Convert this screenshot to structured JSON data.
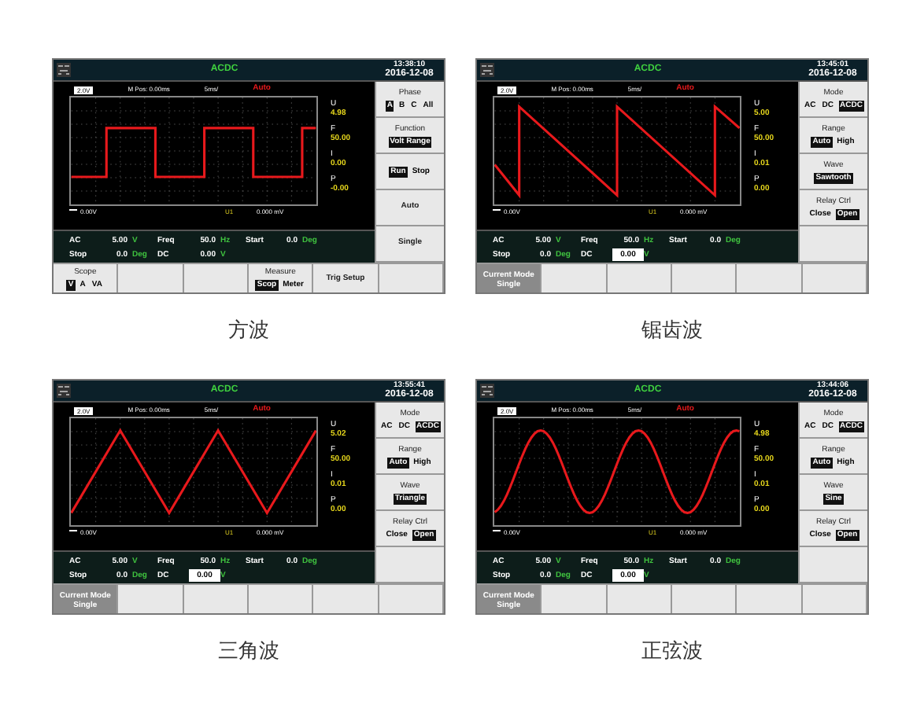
{
  "screens": [
    {
      "title": "ACDC",
      "time": "13:38:10",
      "date": "2016-12-08",
      "plot": {
        "volts_div": "2.0V",
        "m_pos": "M Pos: 0.00ms",
        "time_div": "5ms/",
        "trigger_mode": "Auto",
        "ground_level": "0.00V",
        "cursor": "U1",
        "cursor_value": "0.000 mV",
        "wave": {
          "kind": "square"
        }
      },
      "readings": [
        {
          "label": "U",
          "value": "4.98"
        },
        {
          "label": "F",
          "value": "50.00"
        },
        {
          "label": "I",
          "value": "0.00"
        },
        {
          "label": "P",
          "value": "-0.00"
        }
      ],
      "measurements": [
        [
          {
            "kind": "label",
            "text": "AC"
          },
          {
            "kind": "value",
            "text": "5.00"
          },
          {
            "kind": "unit",
            "text": "V"
          },
          {
            "kind": "label",
            "text": "Freq"
          },
          {
            "kind": "value",
            "text": "50.0"
          },
          {
            "kind": "unit",
            "text": "Hz"
          },
          {
            "kind": "label",
            "text": "Start"
          },
          {
            "kind": "value",
            "text": "0.0"
          },
          {
            "kind": "unit",
            "text": "Deg"
          }
        ],
        [
          {
            "kind": "label",
            "text": "Stop"
          },
          {
            "kind": "value",
            "text": "0.0"
          },
          {
            "kind": "unit",
            "text": "Deg"
          },
          {
            "kind": "label",
            "text": "DC"
          },
          {
            "kind": "value",
            "text": "0.00"
          },
          {
            "kind": "unit",
            "text": "V"
          }
        ]
      ],
      "side_keys": [
        {
          "kind": "options",
          "title": "Phase",
          "options": [
            {
              "label": "A",
              "selected": true
            },
            {
              "label": "B",
              "selected": false
            },
            {
              "label": "C",
              "selected": false
            },
            {
              "label": "All",
              "selected": false
            }
          ]
        },
        {
          "kind": "options",
          "title": "Function",
          "options": [
            {
              "label": "Volt Range",
              "selected": true
            }
          ]
        },
        {
          "kind": "options",
          "options": [
            {
              "label": "Run",
              "selected": true
            },
            {
              "label": "Stop",
              "selected": false
            }
          ]
        },
        {
          "kind": "label",
          "title": "Auto"
        },
        {
          "kind": "label",
          "title": "Single"
        }
      ],
      "bottom_keys": [
        {
          "kind": "options",
          "title": "Scope",
          "options": [
            {
              "label": "V",
              "selected": true
            },
            {
              "label": "A",
              "selected": false
            },
            {
              "label": "VA",
              "selected": false
            }
          ]
        },
        {
          "kind": "empty"
        },
        {
          "kind": "empty"
        },
        {
          "kind": "options",
          "title": "Measure",
          "options": [
            {
              "label": "Scop",
              "selected": true
            },
            {
              "label": "Meter",
              "selected": false
            }
          ]
        },
        {
          "kind": "label",
          "title": "Trig Setup"
        },
        {
          "kind": "empty"
        }
      ],
      "caption": "方波"
    },
    {
      "title": "ACDC",
      "time": "13:45:01",
      "date": "2016-12-08",
      "plot": {
        "volts_div": "2.0V",
        "m_pos": "M Pos: 0.00ms",
        "time_div": "5ms/",
        "trigger_mode": "Auto",
        "ground_level": "0.00V",
        "cursor": "U1",
        "cursor_value": "0.000 mV",
        "wave": {
          "kind": "sawtooth"
        }
      },
      "readings": [
        {
          "label": "U",
          "value": "5.00"
        },
        {
          "label": "F",
          "value": "50.00"
        },
        {
          "label": "I",
          "value": "0.01"
        },
        {
          "label": "P",
          "value": "0.00"
        }
      ],
      "measurements": [
        [
          {
            "kind": "label",
            "text": "AC"
          },
          {
            "kind": "value",
            "text": "5.00"
          },
          {
            "kind": "unit",
            "text": "V"
          },
          {
            "kind": "label",
            "text": "Freq"
          },
          {
            "kind": "value",
            "text": "50.0"
          },
          {
            "kind": "unit",
            "text": "Hz"
          },
          {
            "kind": "label",
            "text": "Start"
          },
          {
            "kind": "value",
            "text": "0.0"
          },
          {
            "kind": "unit",
            "text": "Deg"
          }
        ],
        [
          {
            "kind": "label",
            "text": "Stop"
          },
          {
            "kind": "value",
            "text": "0.0"
          },
          {
            "kind": "unit",
            "text": "Deg"
          },
          {
            "kind": "label",
            "text": "DC"
          },
          {
            "kind": "field",
            "text": "0.00"
          },
          {
            "kind": "unit",
            "text": "V"
          }
        ]
      ],
      "side_keys": [
        {
          "kind": "options",
          "title": "Mode",
          "options": [
            {
              "label": "AC",
              "selected": false
            },
            {
              "label": "DC",
              "selected": false
            },
            {
              "label": "ACDC",
              "selected": true
            }
          ]
        },
        {
          "kind": "options",
          "title": "Range",
          "options": [
            {
              "label": "Auto",
              "selected": true
            },
            {
              "label": "High",
              "selected": false
            }
          ]
        },
        {
          "kind": "options",
          "title": "Wave",
          "options": [
            {
              "label": "Sawtooth",
              "selected": true
            }
          ]
        },
        {
          "kind": "options",
          "title": "Relay Ctrl",
          "options": [
            {
              "label": "Close",
              "selected": false
            },
            {
              "label": "Open",
              "selected": true
            }
          ]
        },
        {
          "kind": "empty"
        }
      ],
      "bottom_keys": [
        {
          "kind": "status",
          "title": "Current Mode",
          "value": "Single"
        },
        {
          "kind": "empty"
        },
        {
          "kind": "empty"
        },
        {
          "kind": "empty"
        },
        {
          "kind": "empty"
        },
        {
          "kind": "empty"
        }
      ],
      "caption": "锯齿波"
    },
    {
      "title": "ACDC",
      "time": "13:55:41",
      "date": "2016-12-08",
      "plot": {
        "volts_div": "2.0V",
        "m_pos": "M Pos: 0.00ms",
        "time_div": "5ms/",
        "trigger_mode": "Auto",
        "ground_level": "0.00V",
        "cursor": "U1",
        "cursor_value": "0.000 mV",
        "wave": {
          "kind": "triangle"
        }
      },
      "readings": [
        {
          "label": "U",
          "value": "5.02"
        },
        {
          "label": "F",
          "value": "50.00"
        },
        {
          "label": "I",
          "value": "0.01"
        },
        {
          "label": "P",
          "value": "0.00"
        }
      ],
      "measurements": [
        [
          {
            "kind": "label",
            "text": "AC"
          },
          {
            "kind": "value",
            "text": "5.00"
          },
          {
            "kind": "unit",
            "text": "V"
          },
          {
            "kind": "label",
            "text": "Freq"
          },
          {
            "kind": "value",
            "text": "50.0"
          },
          {
            "kind": "unit",
            "text": "Hz"
          },
          {
            "kind": "label",
            "text": "Start"
          },
          {
            "kind": "value",
            "text": "0.0"
          },
          {
            "kind": "unit",
            "text": "Deg"
          }
        ],
        [
          {
            "kind": "label",
            "text": "Stop"
          },
          {
            "kind": "value",
            "text": "0.0"
          },
          {
            "kind": "unit",
            "text": "Deg"
          },
          {
            "kind": "label",
            "text": "DC"
          },
          {
            "kind": "field",
            "text": "0.00"
          },
          {
            "kind": "unit",
            "text": "V"
          }
        ]
      ],
      "side_keys": [
        {
          "kind": "options",
          "title": "Mode",
          "options": [
            {
              "label": "AC",
              "selected": false
            },
            {
              "label": "DC",
              "selected": false
            },
            {
              "label": "ACDC",
              "selected": true
            }
          ]
        },
        {
          "kind": "options",
          "title": "Range",
          "options": [
            {
              "label": "Auto",
              "selected": true
            },
            {
              "label": "High",
              "selected": false
            }
          ]
        },
        {
          "kind": "options",
          "title": "Wave",
          "options": [
            {
              "label": "Triangle",
              "selected": true
            }
          ]
        },
        {
          "kind": "options",
          "title": "Relay Ctrl",
          "options": [
            {
              "label": "Close",
              "selected": false
            },
            {
              "label": "Open",
              "selected": true
            }
          ]
        },
        {
          "kind": "empty"
        }
      ],
      "bottom_keys": [
        {
          "kind": "status",
          "title": "Current Mode",
          "value": "Single"
        },
        {
          "kind": "empty"
        },
        {
          "kind": "empty"
        },
        {
          "kind": "empty"
        },
        {
          "kind": "empty"
        },
        {
          "kind": "empty"
        }
      ],
      "caption": "三角波"
    },
    {
      "title": "ACDC",
      "time": "13:44:06",
      "date": "2016-12-08",
      "plot": {
        "volts_div": "2.0V",
        "m_pos": "M Pos: 0.00ms",
        "time_div": "5ms/",
        "trigger_mode": "Auto",
        "ground_level": "0.00V",
        "cursor": "U1",
        "cursor_value": "0.000 mV",
        "wave": {
          "kind": "sine"
        }
      },
      "readings": [
        {
          "label": "U",
          "value": "4.98"
        },
        {
          "label": "F",
          "value": "50.00"
        },
        {
          "label": "I",
          "value": "0.01"
        },
        {
          "label": "P",
          "value": "0.00"
        }
      ],
      "measurements": [
        [
          {
            "kind": "label",
            "text": "AC"
          },
          {
            "kind": "value",
            "text": "5.00"
          },
          {
            "kind": "unit",
            "text": "V"
          },
          {
            "kind": "label",
            "text": "Freq"
          },
          {
            "kind": "value",
            "text": "50.0"
          },
          {
            "kind": "unit",
            "text": "Hz"
          },
          {
            "kind": "label",
            "text": "Start"
          },
          {
            "kind": "value",
            "text": "0.0"
          },
          {
            "kind": "unit",
            "text": "Deg"
          }
        ],
        [
          {
            "kind": "label",
            "text": "Stop"
          },
          {
            "kind": "value",
            "text": "0.0"
          },
          {
            "kind": "unit",
            "text": "Deg"
          },
          {
            "kind": "label",
            "text": "DC"
          },
          {
            "kind": "field",
            "text": "0.00"
          },
          {
            "kind": "unit",
            "text": "V"
          }
        ]
      ],
      "side_keys": [
        {
          "kind": "options",
          "title": "Mode",
          "options": [
            {
              "label": "AC",
              "selected": false
            },
            {
              "label": "DC",
              "selected": false
            },
            {
              "label": "ACDC",
              "selected": true
            }
          ]
        },
        {
          "kind": "options",
          "title": "Range",
          "options": [
            {
              "label": "Auto",
              "selected": true
            },
            {
              "label": "High",
              "selected": false
            }
          ]
        },
        {
          "kind": "options",
          "title": "Wave",
          "options": [
            {
              "label": "Sine",
              "selected": true
            }
          ]
        },
        {
          "kind": "options",
          "title": "Relay Ctrl",
          "options": [
            {
              "label": "Close",
              "selected": false
            },
            {
              "label": "Open",
              "selected": true
            }
          ]
        },
        {
          "kind": "empty"
        }
      ],
      "bottom_keys": [
        {
          "kind": "status",
          "title": "Current Mode",
          "value": "Single"
        },
        {
          "kind": "empty"
        },
        {
          "kind": "empty"
        },
        {
          "kind": "empty"
        },
        {
          "kind": "empty"
        },
        {
          "kind": "empty"
        }
      ],
      "caption": "正弦波"
    }
  ]
}
